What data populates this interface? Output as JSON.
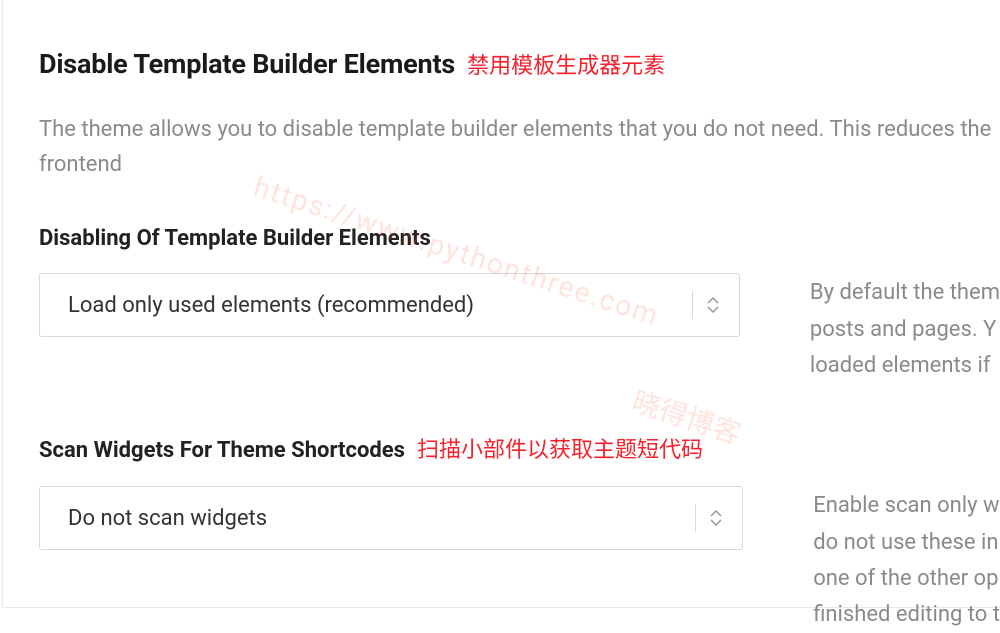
{
  "section": {
    "title": "Disable Template Builder Elements",
    "title_annotation": "禁用模板生成器元素",
    "description": "The theme allows you to disable template builder elements that you do not need. This reduces the frontend"
  },
  "field1": {
    "label": "Disabling Of Template Builder Elements",
    "value": "Load only used elements (recommended)",
    "help": "By default the them\nposts and pages. Y\nloaded elements if"
  },
  "field2": {
    "label": "Scan Widgets For Theme Shortcodes",
    "label_annotation": "扫描小部件以获取主题短代码",
    "value": "Do not scan widgets",
    "help": "Enable scan only w\ndo not use these in\none of the other op\nfinished editing to t"
  },
  "watermarks": {
    "url": "https://www.pythonthree.com",
    "text": "晓得博客"
  }
}
